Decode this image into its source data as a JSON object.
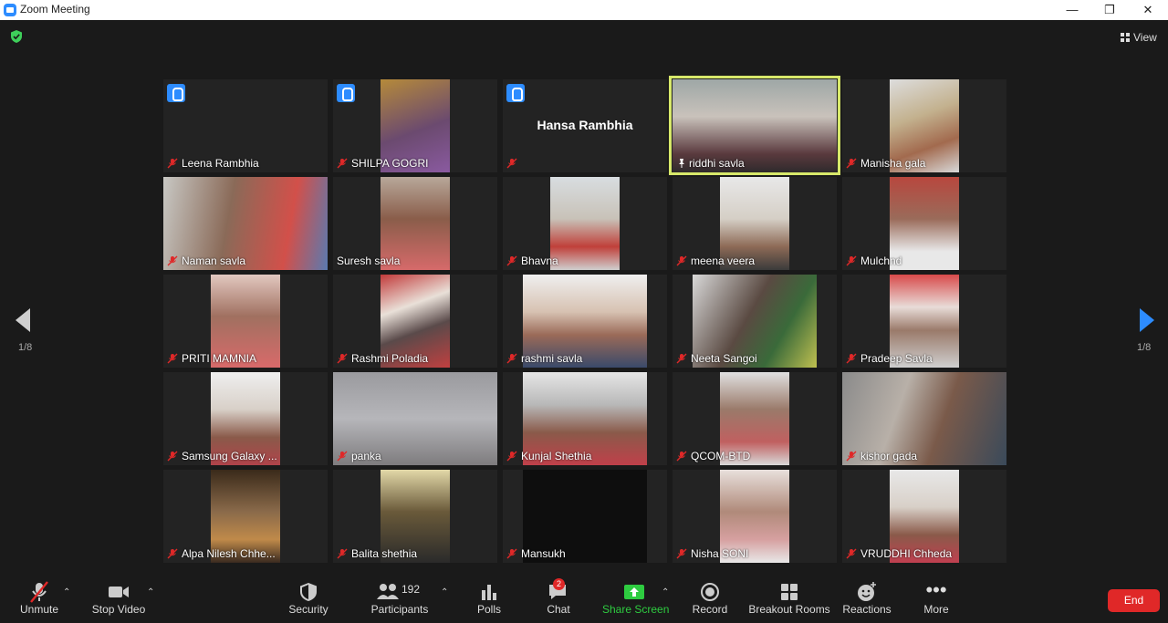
{
  "window": {
    "title": "Zoom Meeting"
  },
  "top": {
    "view_label": "View"
  },
  "nav": {
    "page_left": "1/8",
    "page_right": "1/8"
  },
  "participants": [
    {
      "name": "Leena Rambhia",
      "hand": true,
      "muted": true,
      "video": false
    },
    {
      "name": "SHILPA GOGRI",
      "hand": true,
      "muted": true,
      "video": true
    },
    {
      "name": "",
      "display_name": "Hansa Rambhia",
      "hand": true,
      "muted": true,
      "video": false
    },
    {
      "name": "riddhi savla",
      "pinned": true,
      "video": true
    },
    {
      "name": "Manisha gala",
      "muted": true,
      "video": true
    },
    {
      "name": "Naman savla",
      "muted": true,
      "video": true
    },
    {
      "name": "Suresh savla",
      "muted": false,
      "video": true
    },
    {
      "name": "Bhavna",
      "muted": true,
      "video": true
    },
    {
      "name": "meena veera",
      "muted": true,
      "video": true
    },
    {
      "name": "Mulchnd",
      "muted": true,
      "video": true
    },
    {
      "name": "PRITI MAMNIA",
      "muted": true,
      "video": true
    },
    {
      "name": "Rashmi Poladia",
      "muted": true,
      "video": true
    },
    {
      "name": "rashmi savla",
      "muted": true,
      "video": true
    },
    {
      "name": "Neeta Sangoi",
      "muted": true,
      "video": true
    },
    {
      "name": "Pradeep Savla",
      "muted": true,
      "video": true
    },
    {
      "name": "Samsung Galaxy ...",
      "muted": true,
      "video": true
    },
    {
      "name": "panka",
      "muted": true,
      "video": true
    },
    {
      "name": "Kunjal Shethia",
      "muted": true,
      "video": true
    },
    {
      "name": "QCOM-BTD",
      "muted": true,
      "video": true
    },
    {
      "name": "kishor gada",
      "muted": true,
      "video": true
    },
    {
      "name": "Alpa Nilesh Chhe...",
      "muted": true,
      "video": true
    },
    {
      "name": "Balita shethia",
      "muted": true,
      "video": true
    },
    {
      "name": "Mansukh",
      "muted": true,
      "video": true
    },
    {
      "name": "Nisha SONI",
      "muted": true,
      "video": true
    },
    {
      "name": "VRUDDHI Chheda",
      "muted": true,
      "video": true
    }
  ],
  "toolbar": {
    "unmute": "Unmute",
    "stop_video": "Stop Video",
    "security": "Security",
    "participants": "Participants",
    "participants_count": "192",
    "polls": "Polls",
    "chat": "Chat",
    "chat_badge": "2",
    "share_screen": "Share Screen",
    "record": "Record",
    "breakout_rooms": "Breakout Rooms",
    "reactions": "Reactions",
    "more": "More",
    "end": "End"
  },
  "colors": {
    "accent": "#2d8cff",
    "share_green": "#2ecc40",
    "end_red": "#e02828",
    "pin_highlight": "#d7e86a"
  }
}
